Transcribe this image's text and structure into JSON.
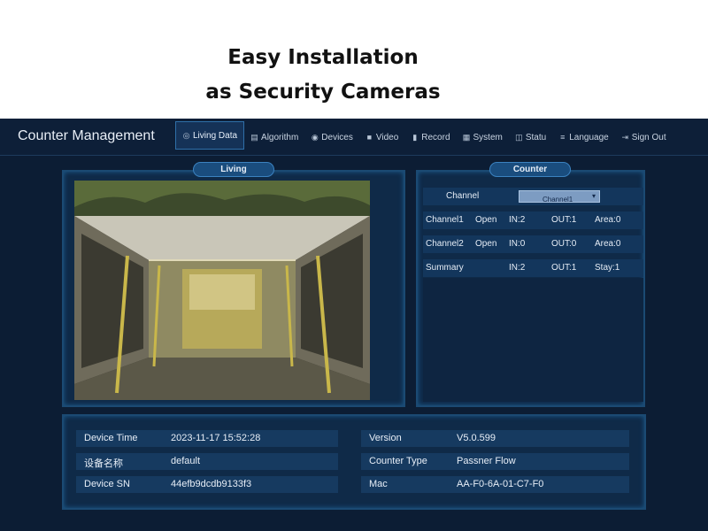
{
  "headline": {
    "line1": "Easy Installation",
    "line2": "as Security Cameras"
  },
  "app": {
    "title": "Counter Management"
  },
  "nav": [
    {
      "label": "Living Data",
      "icon": "camera-icon"
    },
    {
      "label": "Algorithm",
      "icon": "algorithm-icon"
    },
    {
      "label": "Devices",
      "icon": "devices-icon"
    },
    {
      "label": "Video",
      "icon": "video-icon"
    },
    {
      "label": "Record",
      "icon": "record-chart-icon"
    },
    {
      "label": "System",
      "icon": "system-grid-icon"
    },
    {
      "label": "Statu",
      "icon": "status-icon"
    },
    {
      "label": "Language",
      "icon": "language-list-icon"
    },
    {
      "label": "Sign Out",
      "icon": "sign-out-icon"
    }
  ],
  "living": {
    "tab_label": "Living"
  },
  "counter": {
    "tab_label": "Counter",
    "channel_label": "Channel",
    "channel_selected": "Channel1",
    "rows": [
      {
        "name": "Channel1",
        "status": "Open",
        "in": "IN:2",
        "out": "OUT:1",
        "extra": "Area:0"
      },
      {
        "name": "Channel2",
        "status": "Open",
        "in": "IN:0",
        "out": "OUT:0",
        "extra": "Area:0"
      },
      {
        "name": "Summary",
        "status": "",
        "in": "IN:2",
        "out": "OUT:1",
        "extra": "Stay:1"
      }
    ]
  },
  "info": {
    "left": [
      {
        "label": "Device Time",
        "value": "2023-11-17 15:52:28"
      },
      {
        "label": "设备名称",
        "value": "default"
      },
      {
        "label": "Device SN",
        "value": "44efb9dcdb9133f3"
      }
    ],
    "right": [
      {
        "label": "Version",
        "value": "V5.0.599"
      },
      {
        "label": "Counter Type",
        "value": "Passner Flow"
      },
      {
        "label": "Mac",
        "value": "AA-F0-6A-01-C7-F0"
      }
    ]
  },
  "colors": {
    "background": "#0c1d34",
    "panel": "#0f2a48",
    "accent": "#3b82c0",
    "field": "#163a60"
  }
}
